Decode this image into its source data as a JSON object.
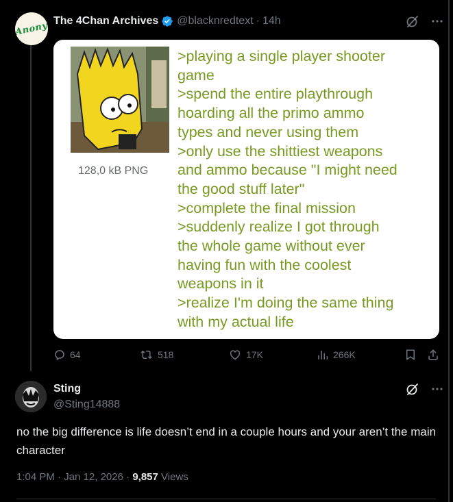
{
  "post": {
    "author_name": "The 4Chan Archives",
    "handle": "@blacknredtext",
    "separator": "·",
    "time": "14h",
    "avatar_text": "Anony",
    "image": {
      "file_size": "128,0 kB PNG",
      "greentext": [
        ">playing a single player shooter",
        "game",
        ">spend the entire playthrough",
        "hoarding all the primo ammo",
        "types and never using them",
        ">only use the shittiest weapons",
        "and ammo because \"I might need",
        "the good stuff later\"",
        ">complete the final mission",
        ">suddenly realize I got through",
        "the whole game without ever",
        "having fun with the coolest",
        "weapons in it",
        ">realize I'm doing the same thing",
        "with my actual life"
      ]
    },
    "actions": {
      "replies": "64",
      "reposts": "518",
      "likes": "17K",
      "views": "266K"
    }
  },
  "reply": {
    "author_name": "Sting",
    "handle": "@Sting14888",
    "text": "no the big difference is life doesn’t end in a couple hours and your aren’t the main character",
    "time": "1:04 PM",
    "date": "Jan 12, 2026",
    "views_count": "9,857",
    "views_label": "Views",
    "separator": "·"
  },
  "colors": {
    "background": "#000000",
    "greentext": "#789922",
    "muted": "#71767b",
    "verified": "#1d9bf0"
  }
}
